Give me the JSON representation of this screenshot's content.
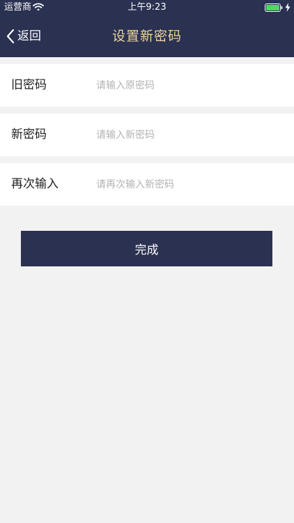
{
  "status_bar": {
    "carrier": "运营商",
    "time": "上午9:23"
  },
  "nav": {
    "back_label": "返回",
    "title": "设置新密码"
  },
  "form": {
    "old_password": {
      "label": "旧密码",
      "placeholder": "请输入原密码",
      "value": ""
    },
    "new_password": {
      "label": "新密码",
      "placeholder": "请输入新密码",
      "value": ""
    },
    "confirm_password": {
      "label": "再次输入",
      "placeholder": "请再次输入新密码",
      "value": ""
    }
  },
  "done_button": {
    "label": "完成"
  },
  "colors": {
    "nav_background": "#2b3151",
    "title_color": "#ecd49a",
    "page_background": "#f2f2f2",
    "battery_color": "#4cd964"
  },
  "icons": {
    "wifi": "wifi-icon",
    "battery": "battery-icon",
    "charging": "charging-bolt-icon",
    "back": "chevron-left-icon"
  }
}
